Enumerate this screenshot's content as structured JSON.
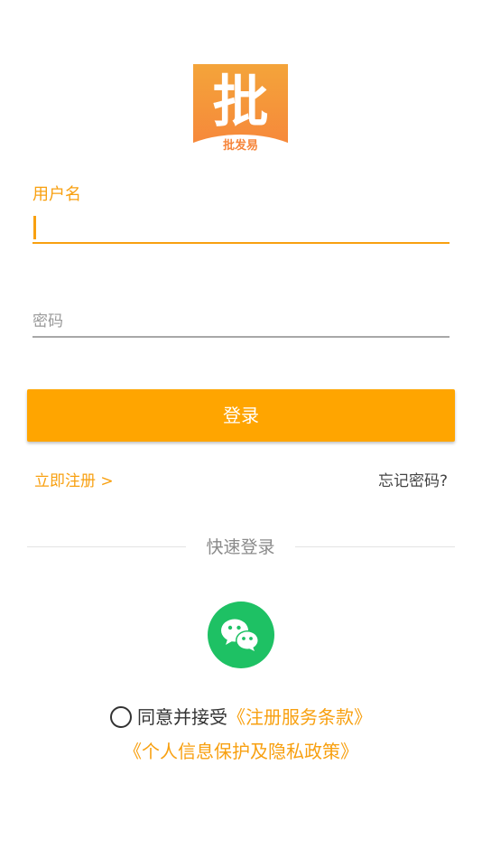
{
  "logo": {
    "glyph": "批",
    "name": "批发易"
  },
  "form": {
    "username_label": "用户名",
    "username_value": "",
    "password_placeholder": "密码",
    "login_label": "登录"
  },
  "links": {
    "register": "立即注册 >",
    "forgot": "忘记密码?"
  },
  "quick_login": {
    "label": "快速登录",
    "wechat_icon": "wechat-icon"
  },
  "agreement": {
    "prefix": "同意并接受",
    "terms": "《注册服务条款》",
    "privacy": "《个人信息保护及隐私政策》"
  },
  "colors": {
    "accent": "#ffa500",
    "wechat": "#1ec164"
  }
}
